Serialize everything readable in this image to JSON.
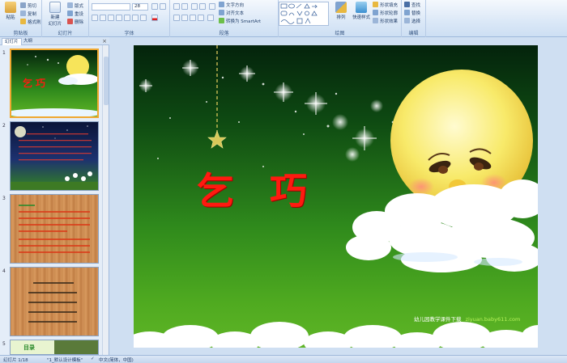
{
  "ribbon": {
    "clipboard": {
      "paste": "粘贴",
      "cut": "剪切",
      "copy": "复制",
      "format_painter": "格式刷",
      "label": "剪贴板"
    },
    "slides": {
      "new_slide": "新建\n幻灯片",
      "layout": "版式",
      "reset": "重设",
      "delete": "删除",
      "label": "幻灯片"
    },
    "font": {
      "size": "28",
      "label": "字体"
    },
    "paragraph": {
      "text_direction": "文字方向",
      "align_text": "对齐文本",
      "convert_smartart": "转换为 SmartArt",
      "label": "段落"
    },
    "drawing": {
      "arrange": "排列",
      "quick_styles": "快速样式",
      "shape_fill": "形状填充",
      "shape_outline": "形状轮廓",
      "shape_effects": "形状效果",
      "label": "绘图"
    },
    "editing": {
      "find": "查找",
      "replace": "替换",
      "select": "选择",
      "label": "编辑"
    }
  },
  "panel": {
    "tabs": [
      "幻灯片",
      "大纲"
    ],
    "close": "×",
    "slot_numbers": [
      "1",
      "2",
      "3",
      "4",
      "5"
    ],
    "thumb1_title": "乞巧",
    "thumb5_title": "目录"
  },
  "slide": {
    "title": "乞  巧",
    "credit_cn": "幼儿园教学课件下载",
    "credit_url": "ziyuan.baby611.com"
  },
  "status": {
    "slide_info": "幻灯片 1/18",
    "theme": "\"1_默认设计模板\"",
    "language": "中文(简体，中国)"
  },
  "colors": {
    "title_red": "#ff1a10",
    "selection_orange": "#f0a830",
    "credit_green": "#b6f25a"
  }
}
